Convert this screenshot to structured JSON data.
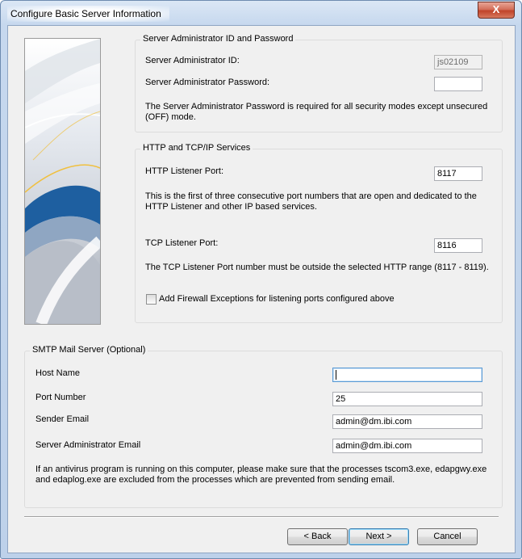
{
  "window": {
    "title": "Configure Basic Server Information",
    "close_glyph": "X"
  },
  "banner": {
    "image": "decorative-waves-banner",
    "colors": [
      "#b6bcc6",
      "#1e5fa0",
      "#f0c040"
    ]
  },
  "admin_group": {
    "legend": "Server Administrator ID and Password",
    "id_label": "Server Administrator ID:",
    "id_value": "js02109",
    "password_label": "Server Administrator Password:",
    "password_value": "",
    "note": "The Server Administrator Password is required for all security modes except unsecured (OFF) mode."
  },
  "http_group": {
    "legend": "HTTP and TCP/IP Services",
    "http_port_label": "HTTP Listener Port:",
    "http_port_value": "8117",
    "http_note": "This is the first of three consecutive port numbers that are open and dedicated to the HTTP Listener and other IP based services.",
    "tcp_port_label": "TCP Listener Port:",
    "tcp_port_value": "8116",
    "tcp_note": "The TCP Listener Port number must be outside the selected HTTP range (8117 - 8119).",
    "firewall_label": "Add Firewall Exceptions for listening ports configured above",
    "firewall_checked": false
  },
  "smtp_group": {
    "legend": "SMTP Mail Server (Optional)",
    "host_label": "Host Name",
    "host_value": "",
    "port_label": "Port Number",
    "port_value": "25",
    "sender_label": "Sender Email",
    "sender_value": "admin@dm.ibi.com",
    "admin_email_label": "Server Administrator Email",
    "admin_email_value": "admin@dm.ibi.com",
    "note": "If an antivirus program is running on this computer, please make sure that the processes tscom3.exe, edapgwy.exe and edaplog.exe are excluded  from the processes which are prevented from sending email."
  },
  "buttons": {
    "back": "< Back",
    "next": "Next >",
    "cancel": "Cancel"
  }
}
